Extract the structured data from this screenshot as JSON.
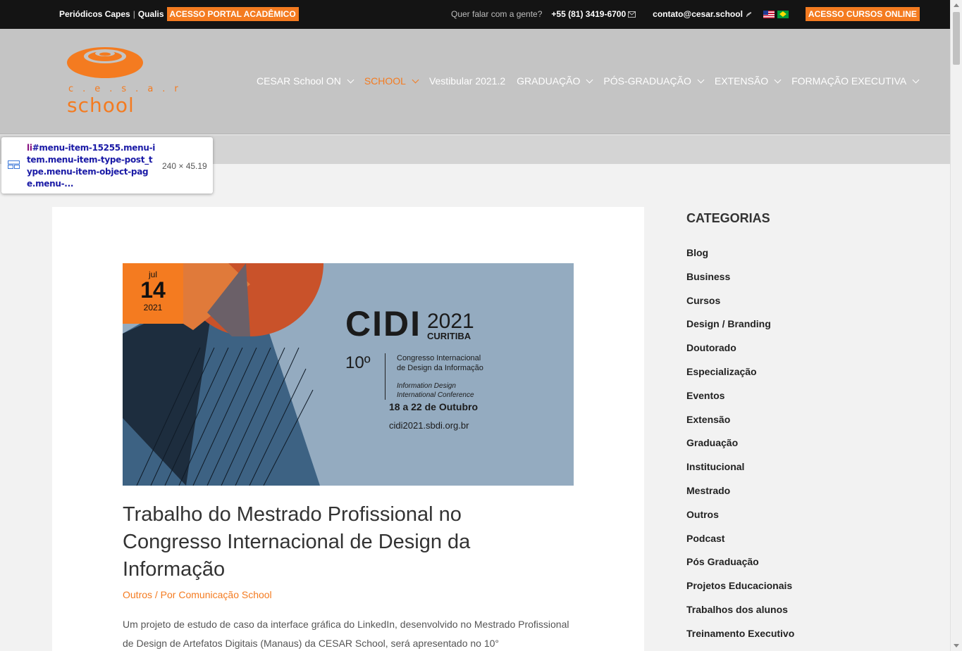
{
  "topbar": {
    "periodicos": "Periódicos Capes",
    "sep": "|",
    "qualis": "Qualis",
    "portal_btn": "ACESSO PORTAL ACADÊMICO",
    "question": "Quer falar com a gente?",
    "phone": "+55 (81) 3419-6700",
    "email": "contato@cesar.school",
    "cursos_btn": "ACESSO CURSOS ONLINE"
  },
  "logo": {
    "cesar": "c.e.s.a.r",
    "school": "school"
  },
  "nav": [
    {
      "label": "CESAR School ON",
      "dropdown": true,
      "active": false
    },
    {
      "label": "SCHOOL",
      "dropdown": true,
      "active": true
    },
    {
      "label": "Vestibular 2021.2",
      "dropdown": false,
      "active": false
    },
    {
      "label": "GRADUAÇÃO",
      "dropdown": true,
      "active": false
    },
    {
      "label": "PÓS-GRADUAÇÃO",
      "dropdown": true,
      "active": false
    },
    {
      "label": "EXTENSÃO",
      "dropdown": true,
      "active": false
    },
    {
      "label": "FORMAÇÃO EXECUTIVA",
      "dropdown": true,
      "active": false
    }
  ],
  "tooltip": {
    "selector_tag": "li",
    "selector_rest": "#menu-item-15255.menu-item.menu-item-type-post_type.menu-item-object-page.menu-...",
    "size": "240 × 45.19"
  },
  "post": {
    "date_month": "jul",
    "date_day": "14",
    "date_year": "2021",
    "image": {
      "cidi": "CIDI",
      "year": "2021",
      "city": "CURITIBA",
      "edition": "10º",
      "line1": "Congresso Internacional",
      "line2": "de Design da Informação",
      "line3": "Information Design",
      "line4": "International Conference",
      "dates": "18 a 22 de Outubro",
      "url": "cidi2021.sbdi.org.br"
    },
    "title": "Trabalho do Mestrado Profissional no Congresso Internacional de Design da Informação",
    "category": "Outros",
    "meta_sep": " / Por ",
    "author": "Comunicação School",
    "excerpt": "Um projeto de estudo de caso da interface gráfica do LinkedIn, desenvolvido no Mestrado Profissional de Design de Artefatos Digitais (Manaus) da CESAR School, será apresentado no 10°"
  },
  "sidebar": {
    "title": "CATEGORIAS",
    "categories": [
      "Blog",
      "Business",
      "Cursos",
      "Design / Branding",
      "Doutorado",
      "Especialização",
      "Eventos",
      "Extensão",
      "Graduação",
      "Institucional",
      "Mestrado",
      "Outros",
      "Podcast",
      "Pós Graduação",
      "Projetos Educacionais",
      "Trabalhos dos alunos",
      "Treinamento Executivo"
    ]
  },
  "colors": {
    "accent": "#f47b20",
    "topbar": "#141414",
    "header": "#c4c4c4"
  }
}
